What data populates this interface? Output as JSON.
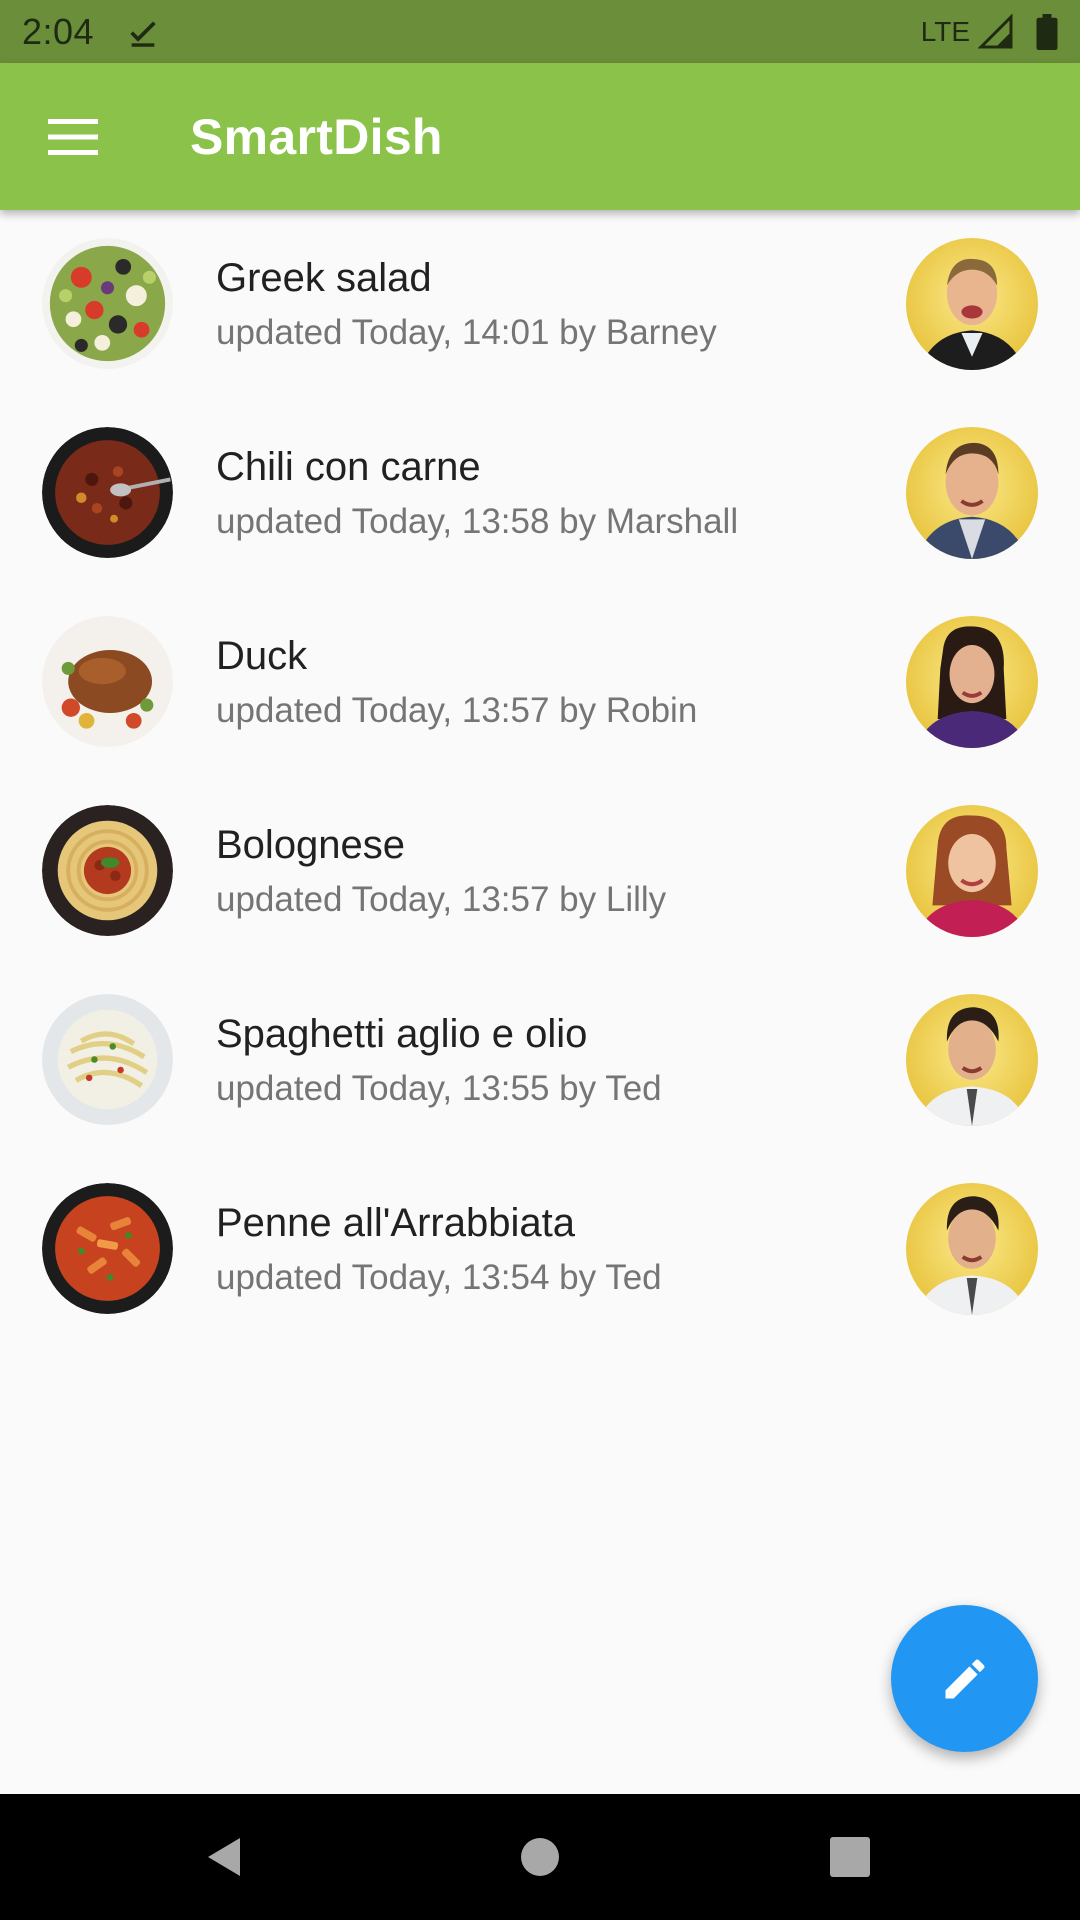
{
  "status_bar": {
    "time": "2:04",
    "network": "LTE",
    "icons": [
      "download-done-icon",
      "signal-icon",
      "battery-icon"
    ]
  },
  "app_bar": {
    "title": "SmartDish",
    "menu_icon": "hamburger-menu-icon",
    "background": "#8bc34a"
  },
  "dishes": [
    {
      "title": "Greek salad",
      "subtitle": "updated Today, 14:01 by Barney",
      "photo": "greek-salad",
      "user": "Barney"
    },
    {
      "title": "Chili con carne",
      "subtitle": "updated Today, 13:58 by Marshall",
      "photo": "chili-con-carne",
      "user": "Marshall"
    },
    {
      "title": "Duck",
      "subtitle": "updated Today, 13:57 by Robin",
      "photo": "duck",
      "user": "Robin"
    },
    {
      "title": "Bolognese",
      "subtitle": "updated Today, 13:57 by Lilly",
      "photo": "bolognese",
      "user": "Lilly"
    },
    {
      "title": "Spaghetti aglio e olio",
      "subtitle": "updated Today, 13:55 by Ted",
      "photo": "spaghetti-aglio-e-olio",
      "user": "Ted"
    },
    {
      "title": "Penne all'Arrabbiata",
      "subtitle": "updated Today, 13:54 by Ted",
      "photo": "penne-arrabbiata",
      "user": "Ted"
    }
  ],
  "fab": {
    "icon": "edit-pencil-icon",
    "color": "#2196f3"
  },
  "nav_bar": {
    "icons": [
      "back-icon",
      "home-icon",
      "recents-icon"
    ]
  }
}
